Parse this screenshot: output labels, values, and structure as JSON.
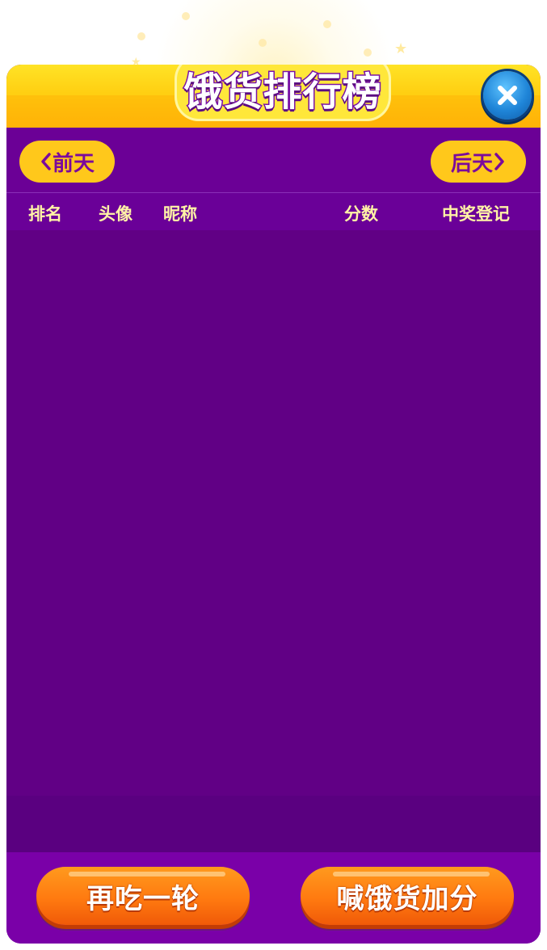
{
  "header": {
    "title": "饿货排行榜",
    "close_icon": "close-icon",
    "accent_color": "#ffcf12",
    "title_outline_color": "#7a12a8"
  },
  "nav": {
    "prev_label": "前天",
    "next_label": "后天",
    "prev_icon": "chevron-left-icon",
    "next_icon": "chevron-right-icon"
  },
  "table": {
    "columns": [
      "排名",
      "头像",
      "昵称",
      "分数",
      "中奖登记"
    ],
    "rows": []
  },
  "actions": {
    "replay_label": "再吃一轮",
    "boost_label": "喊饿货加分"
  },
  "colors": {
    "panel_bg": "#630084",
    "button_orange": "#ff7a10",
    "nav_button_bg": "#ffc81b",
    "column_text": "#fff3a6",
    "close_button_blue": "#1f85d8"
  }
}
